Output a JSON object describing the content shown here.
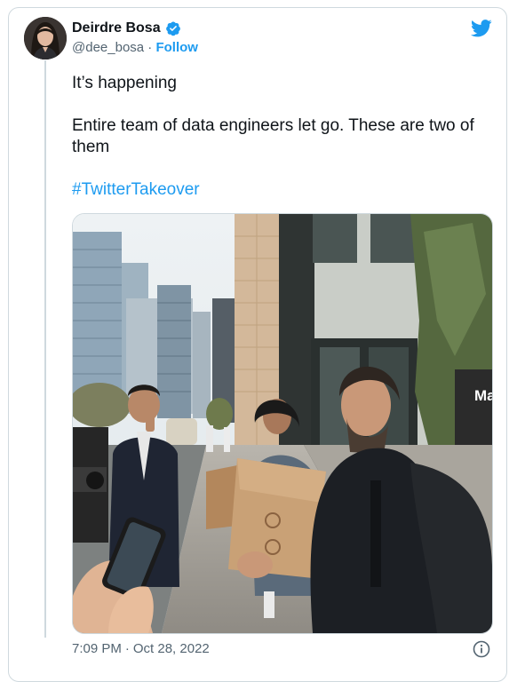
{
  "author": {
    "display_name": "Deirdre Bosa",
    "handle": "@dee_bosa",
    "separator": "·",
    "follow_label": "Follow",
    "verified": true
  },
  "tweet": {
    "line1": "It’s happening",
    "line2": "Entire team of data engineers let go. These are two of them",
    "hashtag": "#TwitterTakeover"
  },
  "media": {
    "sign_text": "Ma"
  },
  "meta": {
    "time": "7:09 PM",
    "separator": "·",
    "date": "Oct 28, 2022"
  },
  "icons": {
    "verified": "verified-badge-icon",
    "brand": "twitter-bird-icon",
    "info": "info-icon"
  },
  "colors": {
    "accent": "#1d9bf0",
    "text": "#0f1419",
    "secondary": "#536471",
    "border": "#cfd9de"
  }
}
